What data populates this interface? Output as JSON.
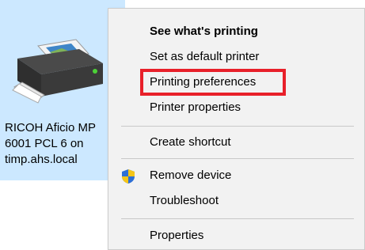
{
  "printer": {
    "label": "RICOH Aficio MP\n6001 PCL 6 on\ntimp.ahs.local",
    "icon": "printer-icon"
  },
  "menu": {
    "items": [
      {
        "label": "See what's printing",
        "bold": true
      },
      {
        "label": "Set as default printer"
      },
      {
        "label": "Printing preferences",
        "highlighted": true
      },
      {
        "label": "Printer properties"
      },
      {
        "label": "Create shortcut"
      },
      {
        "label": "Remove device",
        "icon": "uac-shield-icon"
      },
      {
        "label": "Troubleshoot"
      },
      {
        "label": "Properties"
      }
    ]
  },
  "colors": {
    "selection": "#cce8ff",
    "menu_bg": "#f2f2f2",
    "highlight_border": "#e8202a"
  }
}
